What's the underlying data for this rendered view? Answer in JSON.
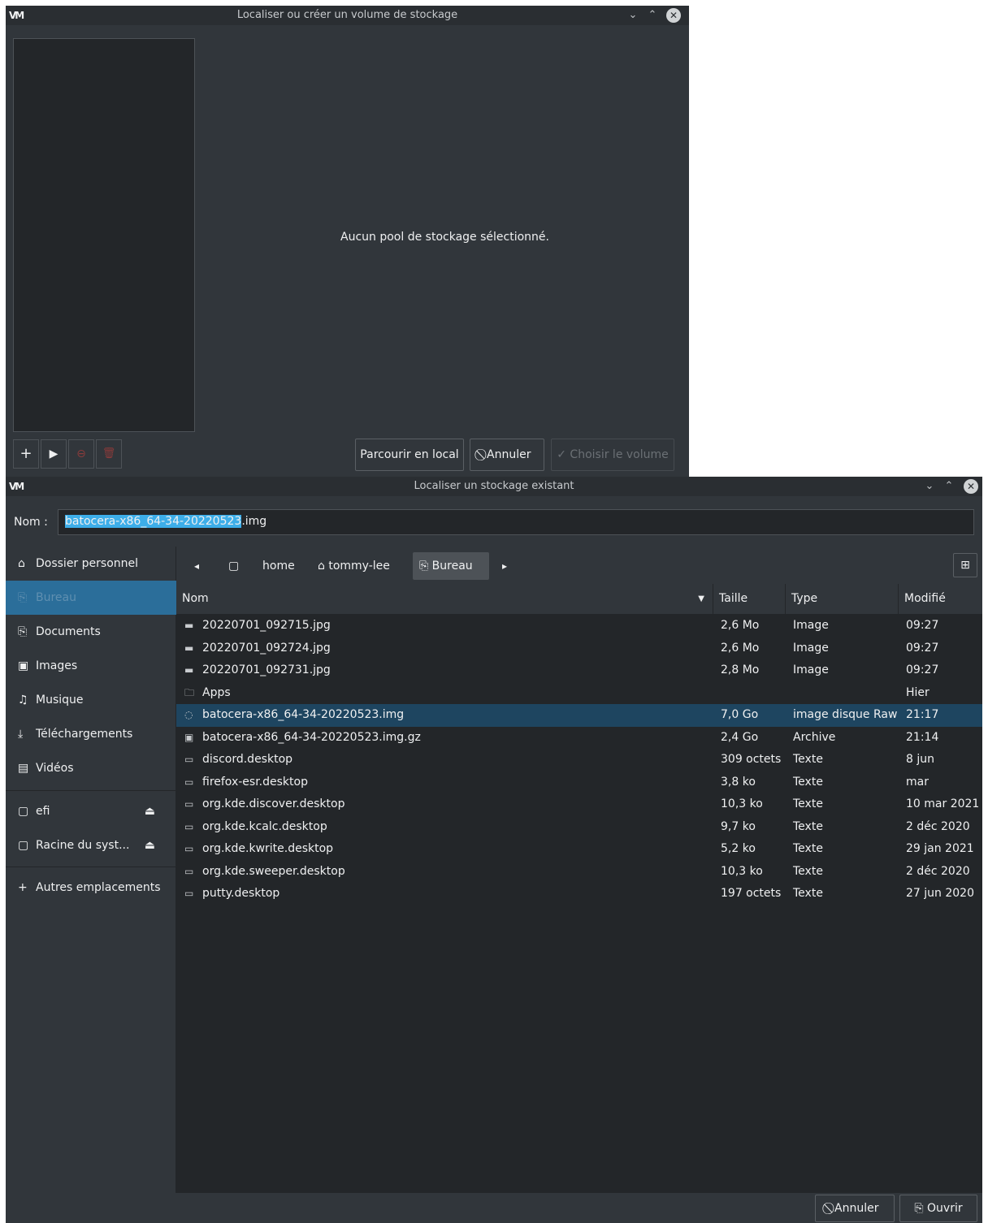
{
  "window1": {
    "title": "Localiser ou créer un volume de stockage",
    "empty_message": "Aucun pool de stockage sélectionné.",
    "toolbar": {
      "add": "+",
      "start": "▶",
      "stop": "⊖",
      "delete": "🗑"
    },
    "buttons": {
      "browse_local": "Parcourir en local",
      "cancel": "⃠ Annuler",
      "choose_volume": "✓ Choisir le volume"
    }
  },
  "window2": {
    "title": "Localiser un stockage existant",
    "name_label": "Nom :",
    "name_value_selected": "batocera-x86_64-34-20220523",
    "name_value_rest": ".img",
    "sidebar": {
      "items": [
        {
          "icon": "⌂",
          "label": "Dossier personnel"
        },
        {
          "icon": "⎘",
          "label": "Bureau"
        },
        {
          "icon": "⎘",
          "label": "Documents"
        },
        {
          "icon": "▣",
          "label": "Images"
        },
        {
          "icon": "♫",
          "label": "Musique"
        },
        {
          "icon": "⤓",
          "label": "Téléchargements"
        },
        {
          "icon": "▤",
          "label": "Vidéos"
        },
        {
          "icon": "▢",
          "label": "efi"
        },
        {
          "icon": "▢",
          "label": "Racine du syst..."
        },
        {
          "icon": "+",
          "label": "Autres emplacements"
        }
      ],
      "eject": "⏏"
    },
    "path": {
      "back": "◂",
      "forward": "▸",
      "crumbs": [
        "▢",
        "home",
        "⌂ tommy-lee",
        "⎘ Bureau"
      ],
      "new_folder": "⊞"
    },
    "columns": [
      "Nom",
      "Taille",
      "Type",
      "Modifié"
    ],
    "files": [
      {
        "icon": "▬",
        "name": "20220701_092715.jpg",
        "size": "2,6 Mo",
        "type": "Image",
        "modified": "09:27"
      },
      {
        "icon": "▬",
        "name": "20220701_092724.jpg",
        "size": "2,6 Mo",
        "type": "Image",
        "modified": "09:27"
      },
      {
        "icon": "▬",
        "name": "20220701_092731.jpg",
        "size": "2,8 Mo",
        "type": "Image",
        "modified": "09:27"
      },
      {
        "icon": "🗀",
        "name": "Apps",
        "size": "",
        "type": "",
        "modified": "Hier"
      },
      {
        "icon": "◌",
        "name": "batocera-x86_64-34-20220523.img",
        "size": "7,0 Go",
        "type": "image disque Raw",
        "modified": "21:17"
      },
      {
        "icon": "▣",
        "name": "batocera-x86_64-34-20220523.img.gz",
        "size": "2,4 Go",
        "type": "Archive",
        "modified": "21:14"
      },
      {
        "icon": "▭",
        "name": "discord.desktop",
        "size": "309 octets",
        "type": "Texte",
        "modified": "8 jun"
      },
      {
        "icon": "▭",
        "name": "firefox-esr.desktop",
        "size": "3,8 ko",
        "type": "Texte",
        "modified": "mar"
      },
      {
        "icon": "▭",
        "name": "org.kde.discover.desktop",
        "size": "10,3 ko",
        "type": "Texte",
        "modified": "10 mar 2021"
      },
      {
        "icon": "▭",
        "name": "org.kde.kcalc.desktop",
        "size": "9,7 ko",
        "type": "Texte",
        "modified": "2 déc 2020"
      },
      {
        "icon": "▭",
        "name": "org.kde.kwrite.desktop",
        "size": "5,2 ko",
        "type": "Texte",
        "modified": "29 jan 2021"
      },
      {
        "icon": "▭",
        "name": "org.kde.sweeper.desktop",
        "size": "10,3 ko",
        "type": "Texte",
        "modified": "2 déc 2020"
      },
      {
        "icon": "▭",
        "name": "putty.desktop",
        "size": "197 octets",
        "type": "Texte",
        "modified": "27 jun 2020"
      }
    ],
    "selected_file_index": 4,
    "buttons": {
      "cancel": "⃠ Annuler",
      "open": "⎘ Ouvrir"
    }
  },
  "colors": {
    "background": "#31363b",
    "view": "#232629",
    "accent": "#3daee9",
    "sidebar_active": "#2b6e9a",
    "row_selected": "#1e4560"
  }
}
